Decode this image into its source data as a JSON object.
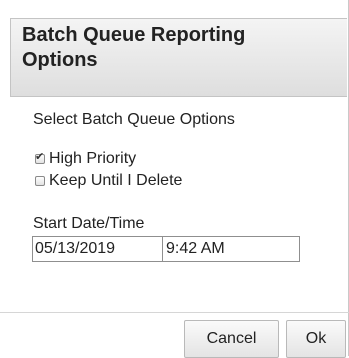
{
  "dialog": {
    "title": "Batch Queue Reporting Options",
    "section_heading": "Select Batch Queue Options",
    "options": [
      {
        "label": "High Priority",
        "checked": true
      },
      {
        "label": "Keep Until I Delete",
        "checked": false
      }
    ],
    "start_label": "Start Date/Time",
    "start_date": "05/13/2019",
    "start_time": "9:42 AM",
    "buttons": {
      "cancel": "Cancel",
      "ok": "Ok"
    },
    "check_glyph": "✔"
  }
}
